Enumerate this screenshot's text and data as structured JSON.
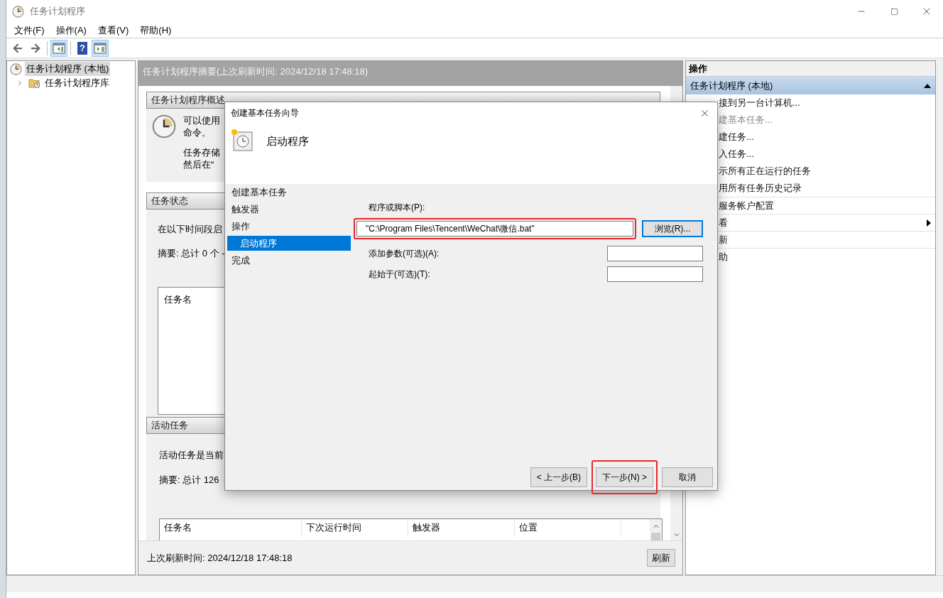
{
  "window": {
    "title": "任务计划程序"
  },
  "menu": [
    "文件(F)",
    "操作(A)",
    "查看(V)",
    "帮助(H)"
  ],
  "toolbar": [
    {
      "kind": "back",
      "pressed": false
    },
    {
      "kind": "forward",
      "pressed": false
    },
    {
      "kind": "tree_pane",
      "pressed": true
    },
    {
      "kind": "help",
      "pressed": false,
      "glyph": "?"
    },
    {
      "kind": "action_pane",
      "pressed": true
    }
  ],
  "tree": [
    {
      "label": "任务计划程序 (本地)",
      "selected": true,
      "children": [
        {
          "label": "任务计划程序库",
          "selected": false,
          "expanded": false
        }
      ]
    }
  ],
  "summary": {
    "header": "任务计划程序摘要(上次刷新时间: 2024/12/18 17:48:18)",
    "overview": {
      "title": "任务计划程序概述",
      "paragraphs": [
        [
          "可以使用",
          "命令。"
        ],
        [
          "任务存储",
          "然后在“"
        ]
      ]
    },
    "status": {
      "title": "任务状态",
      "lines": [
        "在以下时间段启",
        "摘要: 总计 0 个 -"
      ],
      "list_header": "任务名"
    },
    "active": {
      "title": "活动任务",
      "lines": [
        "活动任务是当前",
        "摘要: 总计 126"
      ],
      "table": {
        "columns": [
          "任务名",
          "下次运行时间",
          "触发器",
          "位置"
        ]
      }
    },
    "last_refresh": "上次刷新时间: 2024/12/18 17:48:18",
    "refresh_button": "刷新"
  },
  "actions": {
    "header": "操作",
    "group": {
      "label": "任务计划程序 (本地)",
      "expanded": true
    },
    "items": [
      {
        "label": "接到另一台计算机...",
        "disabled": false,
        "divider_above": false,
        "submenu": false
      },
      {
        "label": "建基本任务...",
        "disabled": true,
        "divider_above": false,
        "submenu": false
      },
      {
        "label": "建任务...",
        "disabled": false,
        "divider_above": false,
        "submenu": false
      },
      {
        "label": "入任务...",
        "disabled": false,
        "divider_above": false,
        "submenu": false
      },
      {
        "label": "示所有正在运行的任务",
        "disabled": false,
        "divider_above": false,
        "submenu": false
      },
      {
        "label": "用所有任务历史记录",
        "disabled": false,
        "divider_above": false,
        "submenu": false
      },
      {
        "label": "服务帐户配置",
        "disabled": false,
        "divider_above": true,
        "submenu": false
      },
      {
        "label": "看",
        "disabled": false,
        "divider_above": true,
        "submenu": true
      },
      {
        "label": "新",
        "disabled": false,
        "divider_above": true,
        "submenu": false
      },
      {
        "label": "助",
        "disabled": false,
        "divider_above": true,
        "submenu": false
      }
    ]
  },
  "dialog": {
    "title": "创建基本任务向导",
    "heading": "启动程序",
    "steps": [
      {
        "label": "创建基本任务",
        "selected": false
      },
      {
        "label": "触发器",
        "selected": false
      },
      {
        "label": "操作",
        "selected": false,
        "children": [
          {
            "label": "启动程序",
            "selected": true
          }
        ]
      },
      {
        "label": "完成",
        "selected": false
      }
    ],
    "fields": [
      {
        "kind": "wide",
        "label": "程序或脚本(P):",
        "value": "\"C:\\Program Files\\Tencent\\WeChat\\微信.bat\"",
        "highlighted": true,
        "button": "浏览(R)..."
      },
      {
        "kind": "inline",
        "label": "添加参数(可选)(A):",
        "highlighted": false
      },
      {
        "kind": "inline",
        "label": "起始于(可选)(T):",
        "highlighted": false
      }
    ],
    "buttons": [
      {
        "label": "< 上一步(B)",
        "highlighted": false
      },
      {
        "label": "下一步(N) >",
        "highlighted": true
      },
      {
        "label": "取消",
        "highlighted": false
      }
    ]
  }
}
